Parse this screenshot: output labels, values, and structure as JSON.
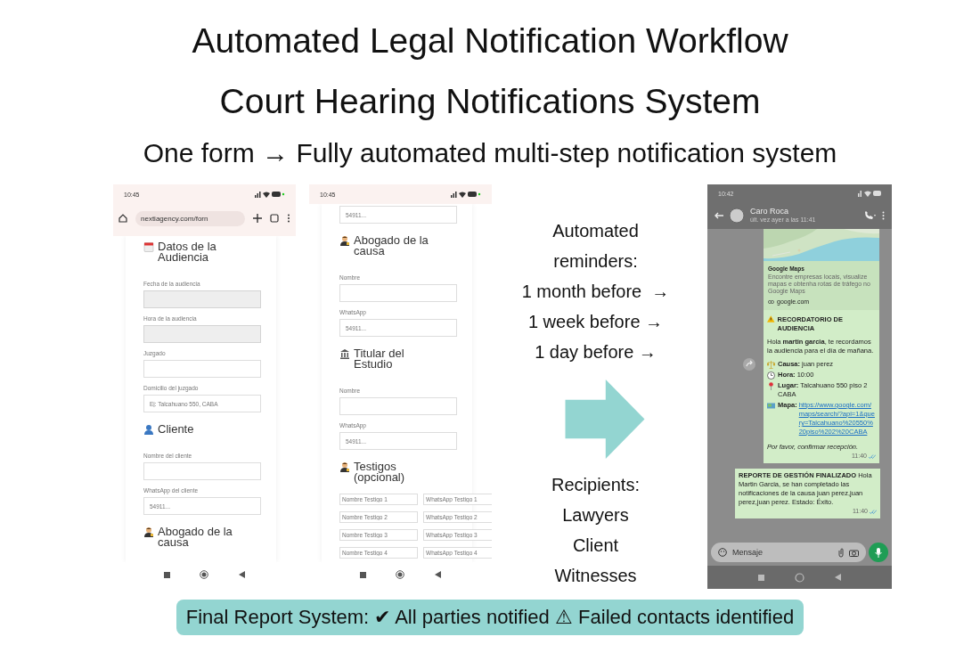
{
  "title_lines": [
    "Automated Legal Notification Workflow",
    "Court Hearing Notifications System"
  ],
  "subtitle": "One form → Fully automated multi-step notification system",
  "form_phones": [
    {
      "time": "10:45",
      "url": "nextiagency.com/forn",
      "sections": [
        {
          "title": "Datos de la Audiencia",
          "fields": [
            {
              "label": "Fecha de la audiencia",
              "kind": "picker"
            },
            {
              "label": "Hora de la audiencia",
              "kind": "picker"
            },
            {
              "label": "Juzgado",
              "kind": "text"
            },
            {
              "label": "Domicilio del juzgado",
              "kind": "text",
              "placeholder": "Ej: Talcahuano 550, CABA"
            }
          ]
        },
        {
          "title": "Cliente",
          "fields": [
            {
              "label": "Nombre del cliente",
              "kind": "text"
            },
            {
              "label": "WhatsApp del cliente",
              "kind": "text",
              "placeholder": "54911..."
            }
          ]
        },
        {
          "title": "Abogado de la causa"
        }
      ]
    },
    {
      "time": "10:45",
      "sections": [
        {
          "fields": [
            {
              "kind": "text",
              "placeholder": "54911..."
            }
          ]
        },
        {
          "title": "Abogado de la causa",
          "fields": [
            {
              "label": "Nombre",
              "kind": "text"
            },
            {
              "label": "WhatsApp",
              "kind": "text",
              "placeholder": "54911..."
            }
          ]
        },
        {
          "title": "Titular del Estudio",
          "fields": [
            {
              "label": "Nombre",
              "kind": "text"
            },
            {
              "label": "WhatsApp",
              "kind": "text",
              "placeholder": "54911..."
            }
          ]
        },
        {
          "title": "Testigos (opcional)",
          "witnesses": [
            {
              "name": {
                "placeholder": "Nombre Testigo 1"
              },
              "whatsapp": {
                "placeholder": "WhatsApp Testigo 1"
              }
            },
            {
              "name": {
                "placeholder": "Nombre Testigo 2"
              },
              "whatsapp": {
                "placeholder": "WhatsApp Testigo 2"
              }
            },
            {
              "name": {
                "placeholder": "Nombre Testigo 3"
              },
              "whatsapp": {
                "placeholder": "WhatsApp Testigo 3"
              }
            },
            {
              "name": {
                "placeholder": "Nombre Testigo 4"
              },
              "whatsapp": {
                "placeholder": "WhatsApp Testigo 4"
              }
            }
          ]
        }
      ]
    }
  ],
  "flow": {
    "reminders_heading": [
      "Automated",
      "reminders:"
    ],
    "reminders": [
      "1 month before  →",
      "1 week before →",
      "1 day before →"
    ],
    "recipients_heading": "Recipients:",
    "recipients": [
      "Lawyers",
      "Client",
      "Witnesses"
    ]
  },
  "chat_phone": {
    "time": "10:42",
    "contact": "Caro Roca",
    "last_seen": "últ. vez ayer a las 11:41",
    "preview": {
      "title": "Google Maps",
      "description": "Encontre empresas locais, visualize mapas e obtenha rotas de tráfego no Google Maps",
      "domain": "google.com"
    },
    "reminder": {
      "title": "RECORDATORIO DE AUDIENCIA",
      "greeting": "Hola **martin garcia**, te recordamos la audiencia para el día de mañana.",
      "details": [
        {
          "text": "**Causa:** juan perez"
        },
        {
          "text": "**Hora:** 10:00"
        },
        {
          "text": "**Lugar:** Talcahuano 550 piso 2 CABA"
        },
        {
          "text": "**Mapa:**",
          "link": "https://www.google.com/maps/search/?api=1&query=Talcahuano%20550%20piso%202%20CABA"
        }
      ],
      "closing": "Por favor, confirmar recepción.",
      "time": "11:40"
    },
    "report": {
      "text": "**REPORTE DE GESTIÓN FINALIZADO** Hola Martin Garcia, se han completado las notificaciones de la causa juan perez,juan perez,juan perez. Estado: Éxito.",
      "time": "11:40"
    },
    "input_placeholder": "Mensaje"
  },
  "footer": "Final Report System: ✔ All parties notified ⚠ Failed contacts identified"
}
